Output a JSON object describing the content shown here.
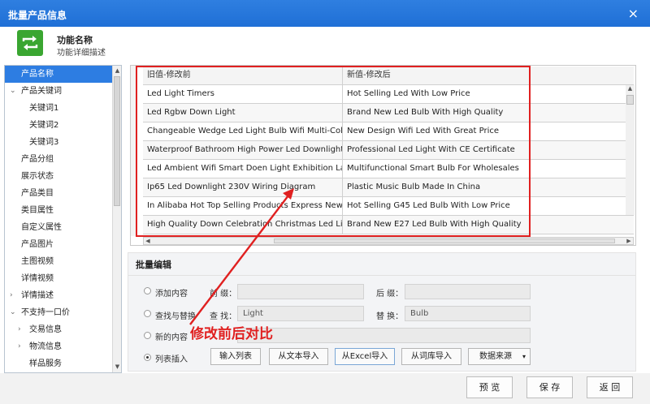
{
  "window": {
    "title": "批量产品信息",
    "close_glyph": "×"
  },
  "header": {
    "title": "功能名称",
    "description": "功能详细描述"
  },
  "sidebar": {
    "items": [
      {
        "label": "产品名称",
        "active": true,
        "arrow": "",
        "sub": false
      },
      {
        "label": "产品关键词",
        "arrow": "⌄",
        "sub": false
      },
      {
        "label": "关键词1",
        "arrow": "",
        "sub": true
      },
      {
        "label": "关键词2",
        "arrow": "",
        "sub": true
      },
      {
        "label": "关键词3",
        "arrow": "",
        "sub": true
      },
      {
        "label": "产品分组",
        "arrow": "",
        "sub": false
      },
      {
        "label": "展示状态",
        "arrow": "",
        "sub": false
      },
      {
        "label": "产品类目",
        "arrow": "",
        "sub": false
      },
      {
        "label": "类目属性",
        "arrow": "",
        "sub": false
      },
      {
        "label": "自定义属性",
        "arrow": "",
        "sub": false
      },
      {
        "label": "产品图片",
        "arrow": "",
        "sub": false
      },
      {
        "label": "主图视频",
        "arrow": "",
        "sub": false
      },
      {
        "label": "详情视频",
        "arrow": "",
        "sub": false
      },
      {
        "label": "详情描述",
        "arrow": "›",
        "sub": false
      },
      {
        "label": "不支持一口价",
        "arrow": "⌄",
        "sub": false
      },
      {
        "label": "交易信息",
        "arrow": "›",
        "sub": true
      },
      {
        "label": "物流信息",
        "arrow": "›",
        "sub": true
      },
      {
        "label": "样品服务",
        "arrow": "",
        "sub": true
      }
    ]
  },
  "grid": {
    "headers": [
      "旧值-修改前",
      "新值-修改后",
      ""
    ],
    "rows": [
      [
        "Led Light Timers",
        "Hot Selling  Led With Low Price",
        ""
      ],
      [
        "Led Rgbw Down Light",
        "Brand New  Led Bulb With High Quality",
        ""
      ],
      [
        "Changeable Wedge Led Light Bulb Wifi Multi-Color",
        "New Design  Wifi Led With Great Price",
        ""
      ],
      [
        "Waterproof Bathroom High Power Led Downlight W",
        "Professional  Led Light With CE Certificate",
        ""
      ],
      [
        "Led Ambient Wifi Smart Doen Light Exhibition Lamp",
        "Multifunctional  Smart Bulb For Wholesales",
        ""
      ],
      [
        "Ip65 Led Downlight 230V Wiring Diagram",
        "Plastic  Music Bulb Made In China",
        ""
      ],
      [
        "In Alibaba Hot Top Selling Products Express New Pr",
        "Hot Selling  G45 Led Bulb With Low Price",
        ""
      ],
      [
        "High Quality Down Celebration Christmas Led Light",
        "Brand New  E27 Led Bulb With High Quality",
        ""
      ]
    ]
  },
  "batch": {
    "title": "批量编辑",
    "add_content_label": "添加内容",
    "prefix_label": "前  缀：",
    "prefix_value": "",
    "suffix_label": "后  缀：",
    "suffix_value": "",
    "find_replace_label": "查找与替换",
    "find_label": "查  找：",
    "find_value": "Light",
    "replace_label": "替  换：",
    "replace_value": "Bulb",
    "new_content_label": "新的内容",
    "new_content_value": "",
    "list_insert_label": "列表插入",
    "selected_option": "列表插入",
    "buttons": {
      "input_list": "输入列表",
      "from_text": "从文本导入",
      "from_excel": "从Excel导入",
      "from_lexicon": "从词库导入",
      "data_source": "数据来源"
    }
  },
  "footer": {
    "preview": "预  览",
    "save": "保  存",
    "back": "返  回"
  },
  "annotation": {
    "text": "修改前后对比",
    "color": "#e02020"
  },
  "colors": {
    "titlebar": "#2f7fe0",
    "accent": "#2d7de2",
    "icon_bg": "#3aa631",
    "highlight_box": "#e02020"
  }
}
